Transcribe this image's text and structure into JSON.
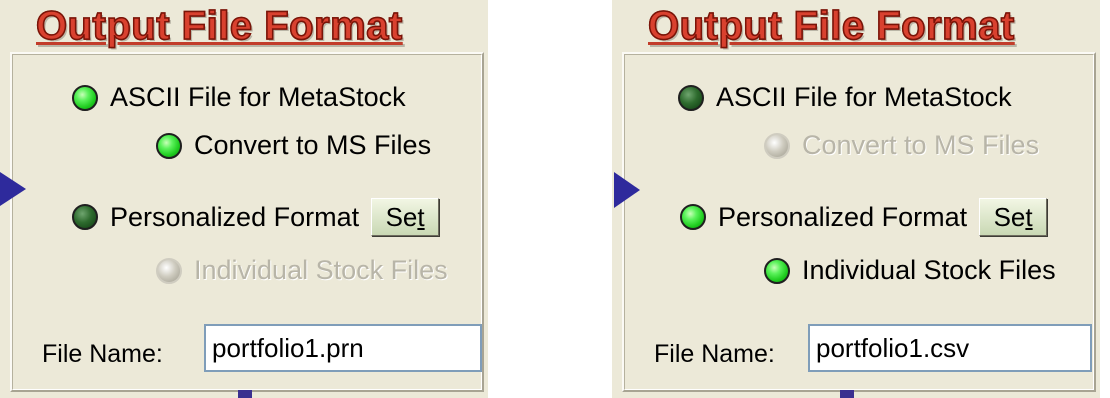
{
  "panels": [
    {
      "title": "Output File Format",
      "ascii_label": "ASCII File for MetaStock",
      "convert_label": "Convert to MS Files",
      "personalized_label": "Personalized Format",
      "set_button_label_pre": "Se",
      "set_button_label_u": "t",
      "individual_label": "Individual Stock Files",
      "file_name_label": "File Name:",
      "file_name_value": "portfolio1.prn"
    },
    {
      "title": "Output File Format",
      "ascii_label": "ASCII File for MetaStock",
      "convert_label": "Convert to MS Files",
      "personalized_label": "Personalized Format",
      "set_button_label_pre": "Se",
      "set_button_label_u": "t",
      "individual_label": "Individual Stock Files",
      "file_name_label": "File Name:",
      "file_name_value": "portfolio1.csv"
    }
  ],
  "colors": {
    "title": "#d9412f",
    "led_on": "#1ecb1e",
    "led_off": "#2e6b2e",
    "arrow": "#2e2a9c",
    "panel_bg": "#ece9d8"
  },
  "icons": {
    "arrow": "left-pointer-triangle",
    "led": "radio-led"
  }
}
